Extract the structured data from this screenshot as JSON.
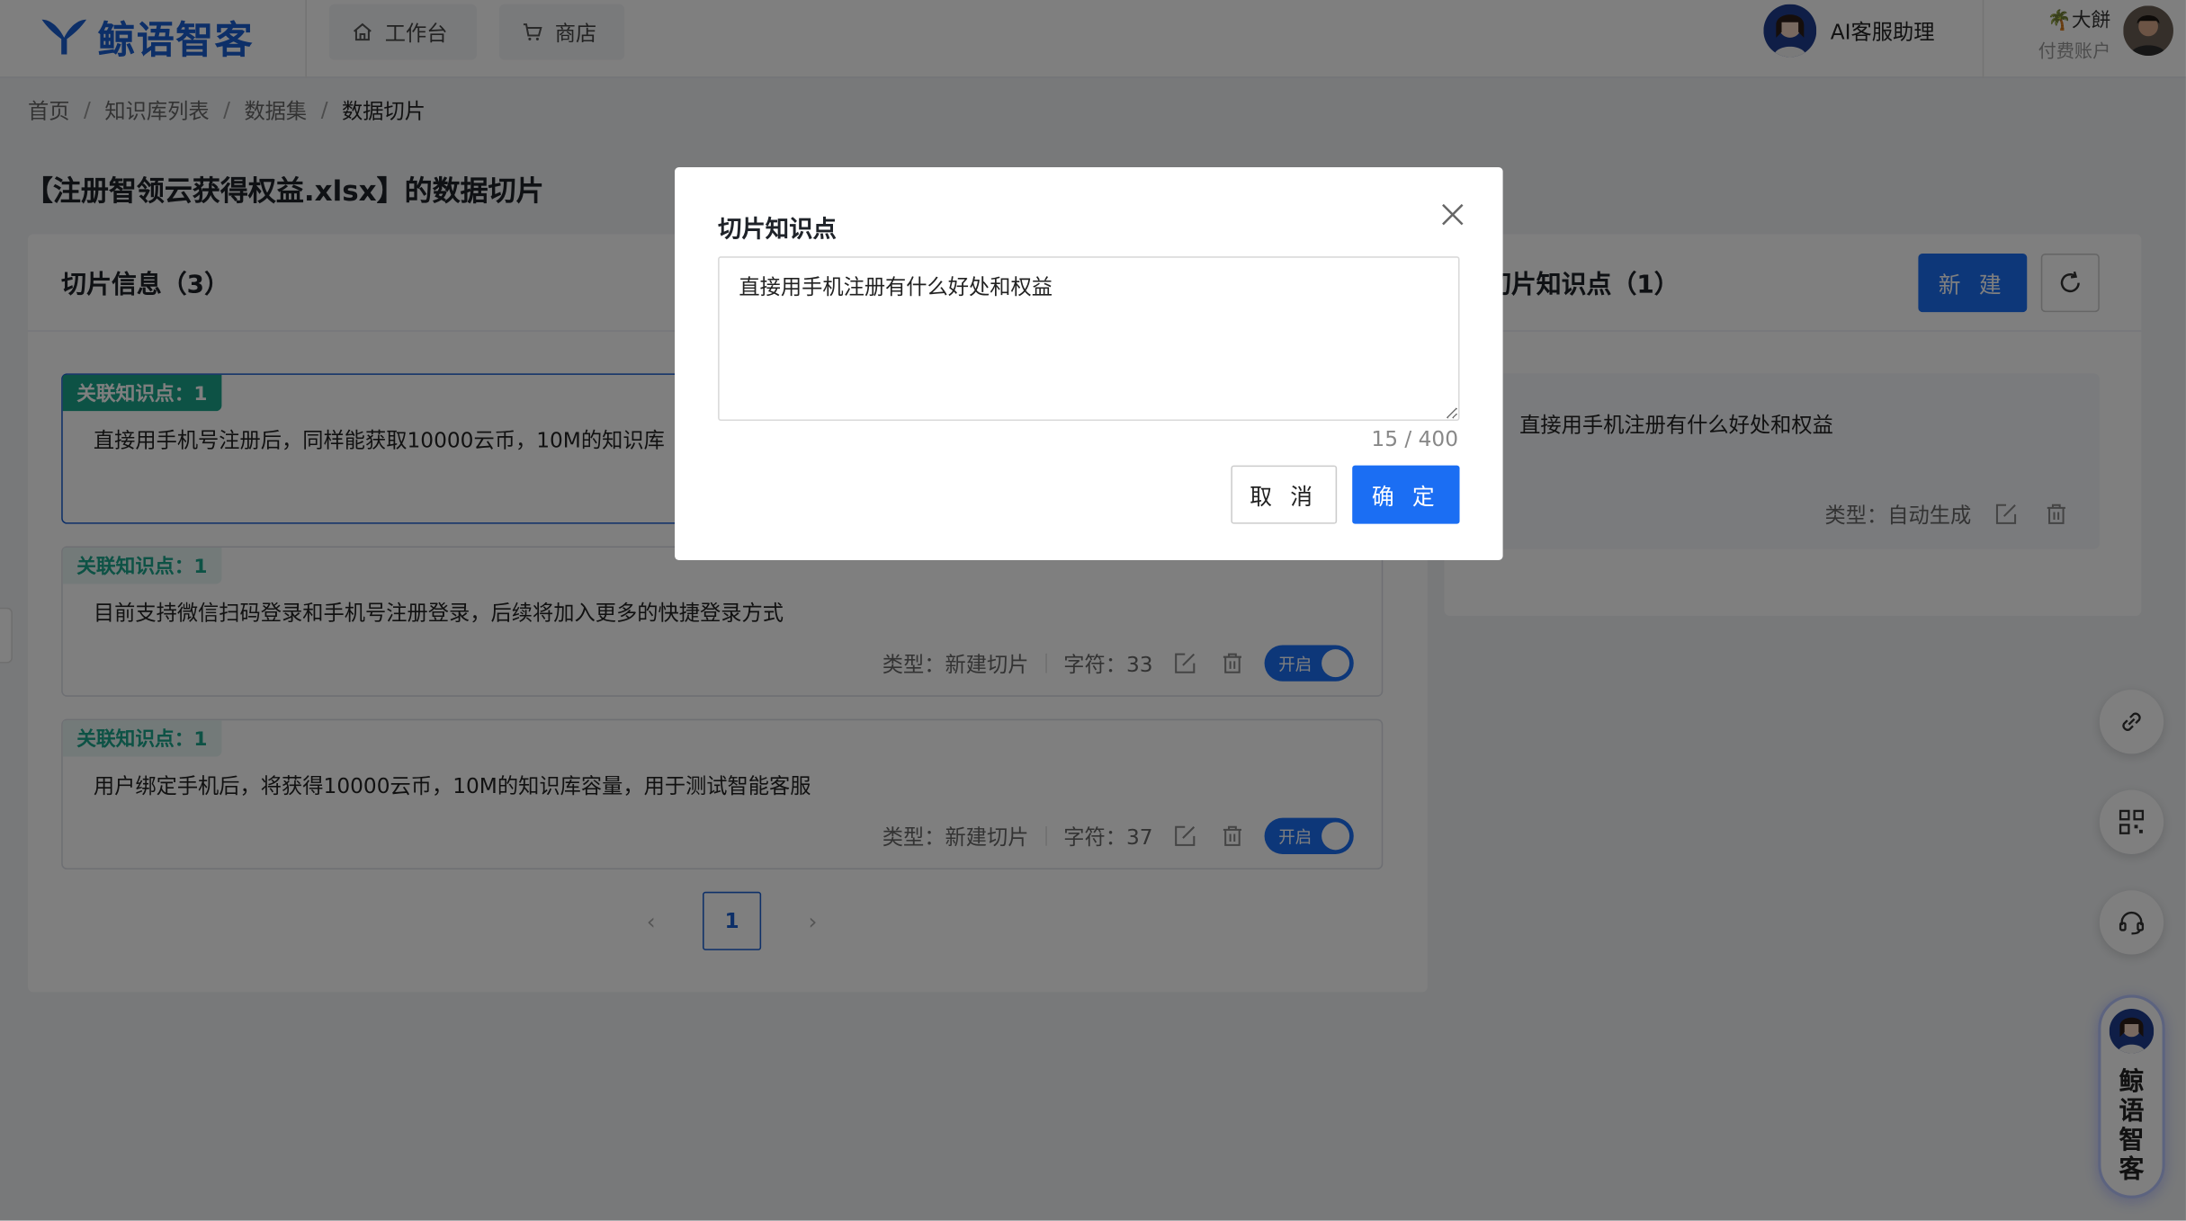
{
  "header": {
    "brand": "鲸语智客",
    "nav": [
      {
        "label": "工作台",
        "icon": "home-icon"
      },
      {
        "label": "商店",
        "icon": "cart-icon"
      }
    ],
    "ai_assistant_label": "AI客服助理",
    "user_name": "大餅",
    "user_role": "付费账户"
  },
  "breadcrumb": [
    "首页",
    "知识库列表",
    "数据集",
    "数据切片"
  ],
  "page_title": "【注册智领云获得权益.xlsx】的数据切片",
  "slices_panel": {
    "title": "切片信息（3）",
    "items": [
      {
        "tag": "关联知识点：1",
        "text": "直接用手机号注册后，同样能获取10000云币，10M的知识库",
        "active": true
      },
      {
        "tag": "关联知识点：1",
        "text": "目前支持微信扫码登录和手机号注册登录，后续将加入更多的快捷登录方式",
        "type": "类型：新建切片",
        "chars": "字符：33",
        "switch": "开启"
      },
      {
        "tag": "关联知识点：1",
        "text": "用户绑定手机后，将获得10000云币，10M的知识库容量，用于测试智能客服",
        "type": "类型：新建切片",
        "chars": "字符：37",
        "switch": "开启"
      }
    ],
    "pagination": {
      "current": "1",
      "prev": "‹",
      "next": "›"
    }
  },
  "knowledge_panel": {
    "title": "切片知识点（1）",
    "new_button": "新 建",
    "items": [
      {
        "text": "直接用手机注册有什么好处和权益",
        "type": "类型：自动生成"
      }
    ]
  },
  "side_brand_text": "鲸语智客",
  "modal": {
    "title": "切片知识点",
    "textarea_value": "直接用手机注册有什么好处和权益",
    "char_count": "15 / 400",
    "cancel_label": "取 消",
    "ok_label": "确 定"
  },
  "colors": {
    "primary": "#1b6ef3",
    "brand": "#1b5fd1",
    "tag_green": "#1aa58a"
  }
}
